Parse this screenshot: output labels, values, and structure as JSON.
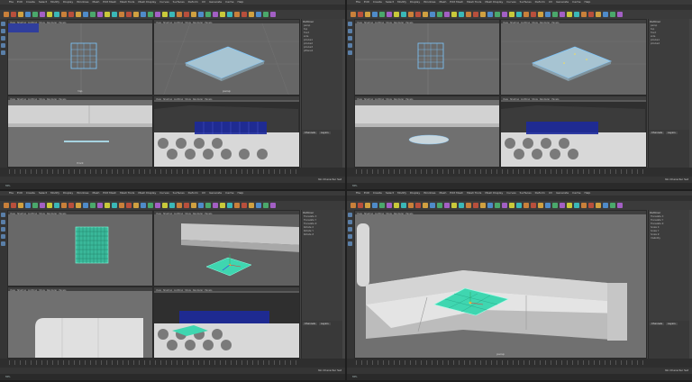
{
  "menus": [
    "File",
    "Edit",
    "Create",
    "Select",
    "Modify",
    "Display",
    "Windows",
    "Mesh",
    "Edit Mesh",
    "Mesh Tools",
    "Mesh Display",
    "Curves",
    "Surfaces",
    "Deform",
    "UV",
    "Generate",
    "Cache",
    "Help"
  ],
  "workspace": "Maya Classic",
  "panel_menu": [
    "View",
    "Shading",
    "Lighting",
    "Show",
    "Renderer",
    "Panels"
  ],
  "viewport_labels": {
    "top": "top",
    "persp": "persp",
    "front": "front",
    "side": "side"
  },
  "outliner": {
    "title": "Outliner",
    "items": [
      "persp",
      "top",
      "front",
      "side",
      "pCube1",
      "pCube2",
      "pCube3",
      "pPlane1",
      "defaultLightSet",
      "defaultObjectSet"
    ]
  },
  "attr_tabs": [
    "Channels",
    "Layers"
  ],
  "channel_names": [
    "Translate X",
    "Translate Y",
    "Translate Z",
    "Rotate X",
    "Rotate Y",
    "Rotate Z",
    "Scale X",
    "Scale Y",
    "Scale Z",
    "Visibility"
  ],
  "range": {
    "start": "1",
    "end": "120"
  },
  "no_char_set": "No Character Set",
  "cmd_text": "MEL",
  "colors": {
    "accent": "#3fd6b0",
    "wire": "#7ec8ff",
    "cloth": "#3ab89a",
    "selection": "#2233aa"
  }
}
